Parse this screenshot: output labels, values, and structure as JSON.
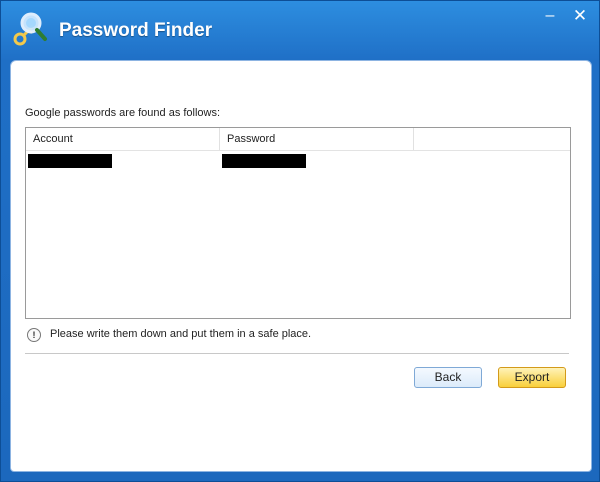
{
  "window": {
    "title": "Password Finder",
    "minimize_label": "–",
    "close_label": "✕",
    "app_icon": "key-magnifier-icon"
  },
  "main": {
    "caption": "Google passwords are found as follows:",
    "table": {
      "columns": [
        "Account",
        "Password",
        ""
      ],
      "rows": [
        {
          "account": "[redacted]",
          "password": "[redacted]"
        }
      ]
    },
    "notice": {
      "icon": "exclamation-icon",
      "icon_glyph": "!",
      "text": "Please write them down and put them in a safe place."
    }
  },
  "footer": {
    "back_label": "Back",
    "export_label": "Export"
  },
  "colors": {
    "title_bar": "#1f6fc6",
    "export_button": "#f9cf3a",
    "back_button": "#dcebfa"
  }
}
